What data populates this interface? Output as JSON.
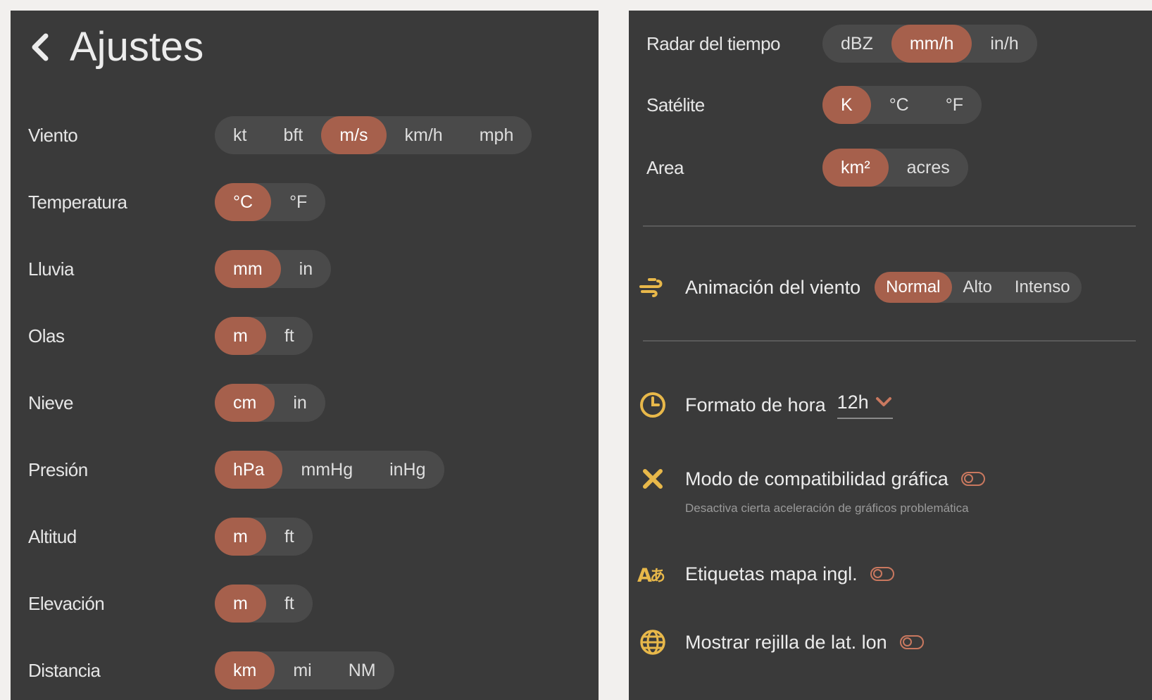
{
  "settings": {
    "title": "Ajustes",
    "units": [
      {
        "label": "Viento",
        "options": [
          "kt",
          "bft",
          "m/s",
          "km/h",
          "mph"
        ],
        "selected": 2
      },
      {
        "label": "Temperatura",
        "options": [
          "°C",
          "°F"
        ],
        "selected": 0
      },
      {
        "label": "Lluvia",
        "options": [
          "mm",
          "in"
        ],
        "selected": 0
      },
      {
        "label": "Olas",
        "options": [
          "m",
          "ft"
        ],
        "selected": 0
      },
      {
        "label": "Nieve",
        "options": [
          "cm",
          "in"
        ],
        "selected": 0
      },
      {
        "label": "Presión",
        "options": [
          "hPa",
          "mmHg",
          "inHg"
        ],
        "selected": 0
      },
      {
        "label": "Altitud",
        "options": [
          "m",
          "ft"
        ],
        "selected": 0
      },
      {
        "label": "Elevación",
        "options": [
          "m",
          "ft"
        ],
        "selected": 0
      },
      {
        "label": "Distancia",
        "options": [
          "km",
          "mi",
          "NM"
        ],
        "selected": 0
      },
      {
        "label": "Radar del tiempo",
        "options": [
          "dBZ",
          "mm/h",
          "in/h"
        ],
        "selected": 1
      },
      {
        "label": "Satélite",
        "options": [
          "K",
          "°C",
          "°F"
        ],
        "selected": 0
      },
      {
        "label": "Area",
        "options": [
          "km²",
          "acres"
        ],
        "selected": 0
      }
    ],
    "wind_animation": {
      "label": "Animación del viento",
      "options": [
        "Normal",
        "Alto",
        "Intenso"
      ],
      "selected": 0,
      "icon": "wind-icon"
    },
    "time_format": {
      "label": "Formato de hora",
      "value": "12h",
      "icon": "clock-icon"
    },
    "graphics_compat": {
      "label": "Modo de compatibilidad gráfica",
      "description": "Desactiva cierta aceleración de gráficos problemática",
      "enabled": false,
      "icon": "close-x-icon"
    },
    "english_labels": {
      "label": "Etiquetas mapa ingl.",
      "enabled": false,
      "icon": "translate-icon"
    },
    "latlon_grid": {
      "label": "Mostrar rejilla de lat. lon",
      "enabled": false,
      "icon": "globe-icon"
    }
  },
  "colors": {
    "panel_bg": "#3a3a3a",
    "segment_bg": "#4a4a4a",
    "accent": "#a6604c",
    "icon_accent": "#e8b84a",
    "toggle_outline": "#c9785f"
  }
}
